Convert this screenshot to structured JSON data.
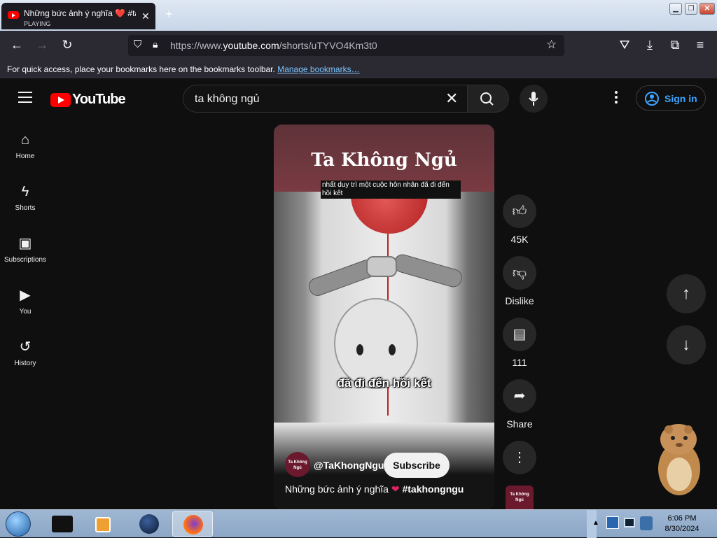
{
  "browser": {
    "tab": {
      "title": "Những bức ảnh ý nghĩa ❤️ #ta",
      "status": "PLAYING",
      "close": "✕"
    },
    "new_tab": "+",
    "url": {
      "prefix": "https://www.",
      "domain": "youtube.com",
      "path": "/shorts/uTYVO4Km3t0"
    },
    "bookmarks_text": "For quick access, place your bookmarks here on the bookmarks toolbar.",
    "bookmarks_link": "Manage bookmarks…"
  },
  "youtube": {
    "logo_text": "YouTube",
    "search_value": "ta không ngủ",
    "sign_in": "Sign in",
    "sidebar": [
      {
        "label": "Home",
        "icon": "⌂"
      },
      {
        "label": "Shorts",
        "icon": "ϟ"
      },
      {
        "label": "Subscriptions",
        "icon": "▣"
      },
      {
        "label": "You",
        "icon": "▶"
      },
      {
        "label": "History",
        "icon": "↺"
      }
    ]
  },
  "video": {
    "title": "Ta Không Ngủ",
    "subtitle_top": "nhất duy trì một cuộc hôn nhân đã đi đến hồi kết",
    "caption": "đã đi đến hồi kết",
    "channel_avatar_text": "Ta Không Ngủ",
    "channel": "@TaKhongNgu",
    "subscribe": "Subscribe",
    "description": "Những bức ảnh ý nghĩa",
    "hashtag": "#takhongngu"
  },
  "actions": {
    "like": "45K",
    "dislike": "Dislike",
    "comments": "111",
    "share": "Share"
  },
  "taskbar": {
    "time": "6:06 PM",
    "date": "8/30/2024"
  },
  "colors": {
    "youtube_red": "#ff0000",
    "link_blue": "#3ea6ff",
    "bg": "#0f0f0f"
  }
}
